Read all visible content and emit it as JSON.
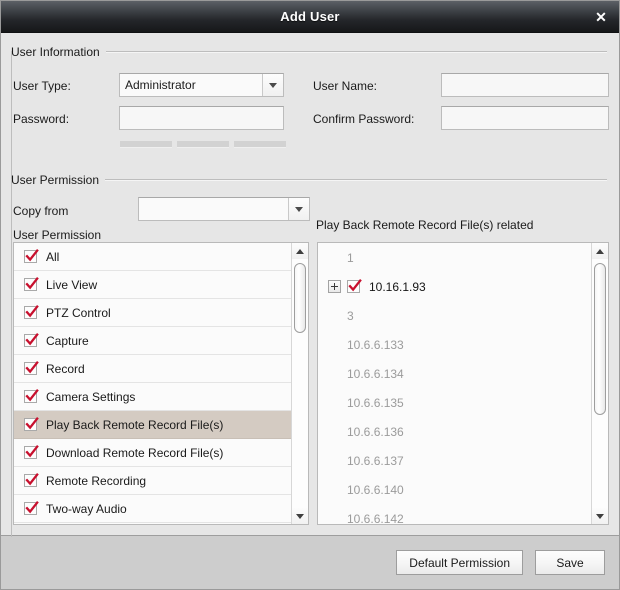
{
  "window": {
    "title": "Add User",
    "close_icon": "close-icon"
  },
  "user_information": {
    "group_label": "User Information",
    "user_type_label": "User Type:",
    "user_type_value": "Administrator",
    "user_name_label": "User Name:",
    "user_name_value": "",
    "user_name_placeholder": "",
    "password_label": "Password:",
    "password_value": "",
    "password_placeholder": "",
    "confirm_password_label": "Confirm Password:",
    "confirm_password_value": "",
    "confirm_password_placeholder": "",
    "password_strength_segments": 3
  },
  "user_permission": {
    "group_label": "User Permission",
    "copy_from_label": "Copy from",
    "copy_from_value": "",
    "list_label": "User Permission",
    "permissions": [
      {
        "label": "All",
        "checked": true,
        "selected": false
      },
      {
        "label": "Live View",
        "checked": true,
        "selected": false
      },
      {
        "label": "PTZ Control",
        "checked": true,
        "selected": false
      },
      {
        "label": "Capture",
        "checked": true,
        "selected": false
      },
      {
        "label": "Record",
        "checked": true,
        "selected": false
      },
      {
        "label": "Camera Settings",
        "checked": true,
        "selected": false
      },
      {
        "label": "Play Back Remote Record File(s)",
        "checked": true,
        "selected": true
      },
      {
        "label": "Download Remote Record File(s)",
        "checked": true,
        "selected": false
      },
      {
        "label": "Remote Recording",
        "checked": true,
        "selected": false
      },
      {
        "label": "Two-way Audio",
        "checked": true,
        "selected": false
      }
    ]
  },
  "related_panel": {
    "title": "Play Back Remote Record File(s) related",
    "nodes": [
      {
        "label": "1",
        "dim": true,
        "checkbox": false,
        "expander": false
      },
      {
        "label": "10.16.1.93",
        "dim": false,
        "checkbox": true,
        "checked": true,
        "expander": true
      },
      {
        "label": "3",
        "dim": true,
        "checkbox": false,
        "expander": false
      },
      {
        "label": "10.6.6.133",
        "dim": true,
        "checkbox": false,
        "expander": false
      },
      {
        "label": "10.6.6.134",
        "dim": true,
        "checkbox": false,
        "expander": false
      },
      {
        "label": "10.6.6.135",
        "dim": true,
        "checkbox": false,
        "expander": false
      },
      {
        "label": "10.6.6.136",
        "dim": true,
        "checkbox": false,
        "expander": false
      },
      {
        "label": "10.6.6.137",
        "dim": true,
        "checkbox": false,
        "expander": false
      },
      {
        "label": "10.6.6.140",
        "dim": true,
        "checkbox": false,
        "expander": false
      },
      {
        "label": "10.6.6.142",
        "dim": true,
        "checkbox": false,
        "expander": false
      }
    ]
  },
  "footer": {
    "default_permission_label": "Default Permission",
    "save_label": "Save"
  },
  "colors": {
    "accent_check": "#c8102e",
    "selection": "#d4cbc2",
    "titlebar": "#24262a",
    "dialog_bg": "#e6e6e6",
    "footer_bg": "#cdcdcd"
  }
}
